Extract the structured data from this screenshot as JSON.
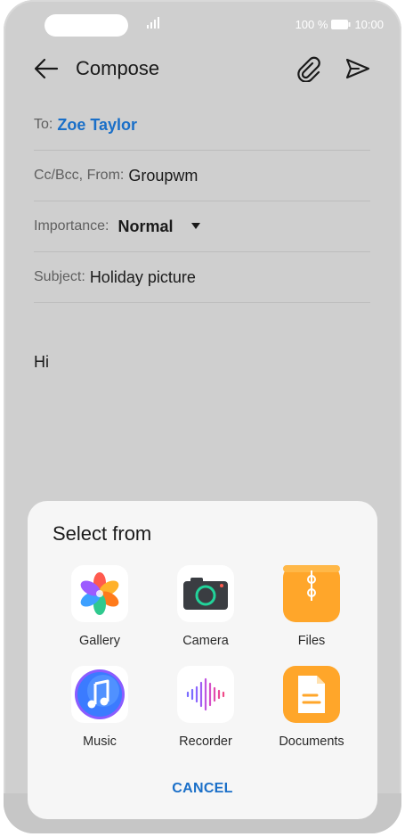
{
  "status_bar": {
    "battery": "100 %",
    "time": "10:00"
  },
  "header": {
    "title": "Compose",
    "back_icon": "arrow-left-icon",
    "attach_icon": "paperclip-icon",
    "send_icon": "send-icon"
  },
  "form": {
    "to_label": "To:",
    "to_value": "Zoe Taylor",
    "ccbcc_label": "Cc/Bcc, From:",
    "from_value": "Groupwm",
    "importance_label": "Importance:",
    "importance_value": "Normal",
    "subject_label": "Subject:",
    "subject_value": "Holiday picture"
  },
  "message_body": "Hi",
  "sheet": {
    "title": "Select from",
    "apps": [
      {
        "label": "Gallery",
        "icon": "gallery-icon"
      },
      {
        "label": "Camera",
        "icon": "camera-icon"
      },
      {
        "label": "Files",
        "icon": "files-icon"
      },
      {
        "label": "Music",
        "icon": "music-icon"
      },
      {
        "label": "Recorder",
        "icon": "recorder-icon"
      },
      {
        "label": "Documents",
        "icon": "documents-icon"
      }
    ],
    "cancel_label": "CANCEL"
  },
  "colors": {
    "accent": "#1a6fc8",
    "screen_background": "#cfcfcf",
    "sheet_background": "#f6f6f6"
  }
}
